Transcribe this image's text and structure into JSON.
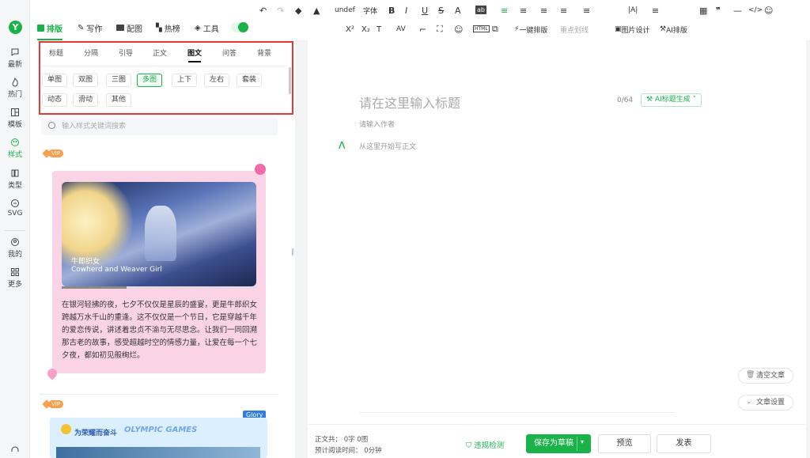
{
  "nav": {
    "logo": "Y",
    "items": [
      {
        "label": "最新",
        "icon": "chat-bubble-icon"
      },
      {
        "label": "热门",
        "icon": "flame-icon"
      },
      {
        "label": "模板",
        "icon": "template-icon"
      },
      {
        "label": "样式",
        "icon": "style-icon",
        "active": true
      },
      {
        "label": "类型",
        "icon": "type-book-icon"
      },
      {
        "label": "SVG",
        "icon": "svg-icon"
      },
      {
        "label": "我的",
        "icon": "user-icon"
      },
      {
        "label": "更多",
        "icon": "grid-icon"
      }
    ]
  },
  "top_tabs": [
    {
      "label": "排版",
      "icon": "layout-icon",
      "active": true
    },
    {
      "label": "写作",
      "icon": "pen-icon"
    },
    {
      "label": "配图",
      "icon": "image-icon"
    },
    {
      "label": "热榜",
      "icon": "bookmark-icon"
    },
    {
      "label": "工具",
      "icon": "cube-icon"
    }
  ],
  "toolbar": {
    "row1": [
      "↶",
      "↷",
      "◆",
      "▲",
      "undef",
      "字体",
      "B",
      "I",
      "U",
      "S",
      "A",
      "ab",
      "≡",
      "≡",
      "≡",
      "≡",
      "≡",
      "|A|",
      "≡",
      "▦",
      "❞",
      "—",
      "</>",
      "☺"
    ],
    "font_family_value": "undef",
    "font_size_label": "字体",
    "row2_items": [
      "X²",
      "X₂",
      "T",
      "AV",
      "⌐",
      "⛶",
      "☺",
      "HTML",
      "⧉"
    ],
    "one_click": "一键排版",
    "key_line": "重点划线",
    "image_design": "图片设计",
    "ai_layout": "AI排版"
  },
  "style_panel": {
    "tabs": [
      "标题",
      "分隔",
      "引导",
      "正文",
      "图文",
      "问答",
      "背景"
    ],
    "active_tab": "图文",
    "chips_row1": [
      "单图",
      "双图",
      "三图",
      "多图",
      "上下",
      "左右",
      "套装"
    ],
    "chips_row2": [
      "动态",
      "滑动",
      "其他"
    ],
    "active_chip": "多图",
    "search_placeholder": "输入样式关键词搜索"
  },
  "cards": [
    {
      "badge": "VIP",
      "image_caption_cn": "牛郎织女",
      "image_caption_en": "Cowherd and Weaver Girl",
      "text": "在银河轻拂的夜，七夕不仅仅是星辰的盛宴，更是牛郎织女跨越万水千山的重逢。这不仅仅是一个节日，它是穿越千年的爱恋传说，讲述着忠贞不渝与无尽思念。让我们一同回溯那古老的故事，感受超越时空的情感力量，让爱在每一个七夕夜，都如初见般绚烂。"
    },
    {
      "badge": "VIP",
      "title": "为荣耀而奋斗",
      "title_en": "OLYMPIC GAMES",
      "tag": "Glory"
    }
  ],
  "editor": {
    "title_placeholder": "请在这里输入标题",
    "title_count": "0/64",
    "ai_title_btn": "AI标题生成",
    "author_placeholder": "请输入作者",
    "body_placeholder": "从这里开始写正文"
  },
  "side_buttons": {
    "clear": "清空文章",
    "settings": "文章设置"
  },
  "footer": {
    "word_count": "正文共： 0字 0图",
    "read_time": "预计阅读时间： 0分钟",
    "check": "违规检测",
    "save": "保存为草稿",
    "preview": "预览",
    "publish": "发表"
  },
  "colors": {
    "accent": "#19b34a",
    "highlight_border": "#e53935"
  }
}
